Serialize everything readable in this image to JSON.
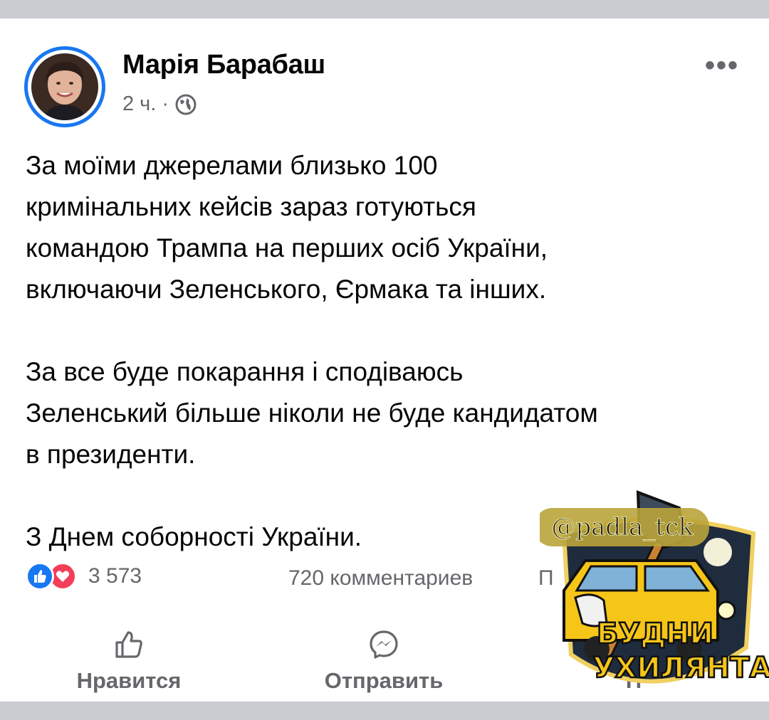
{
  "post": {
    "author": "Марія Барабаш",
    "time": "2 ч.",
    "separator": "·",
    "privacy_icon": "globe-icon",
    "more_label": "•••",
    "paragraphs": [
      [
        "За моїми джерелами близько 100",
        "кримінальних кейсів зараз готуються",
        "командою Трампа на перших осіб України,",
        "включаючи Зеленського, Єрмака та інших."
      ],
      [
        "За все буде покарання і сподіваюсь",
        "Зеленський більше ніколи не буде кандидатом",
        "в президенти."
      ],
      [
        "З Днем соборності України."
      ]
    ]
  },
  "stats": {
    "reaction_icons": [
      "like-icon",
      "love-icon"
    ],
    "reactions_count": "3 573",
    "comments": "720 комментариев",
    "shares_partial": "П"
  },
  "actions": {
    "like": "Нравится",
    "send": "Отправить",
    "share_partial": "П"
  },
  "watermark": {
    "handle": "@padla_tck",
    "line1": "БУДНИ",
    "line2": "УХИЛЯНТА"
  },
  "colors": {
    "accent": "#1877f2",
    "love": "#f33e58",
    "secondary_text": "#65676b",
    "badge_yellow": "#f5c518",
    "badge_dark": "#1f2c3d"
  }
}
